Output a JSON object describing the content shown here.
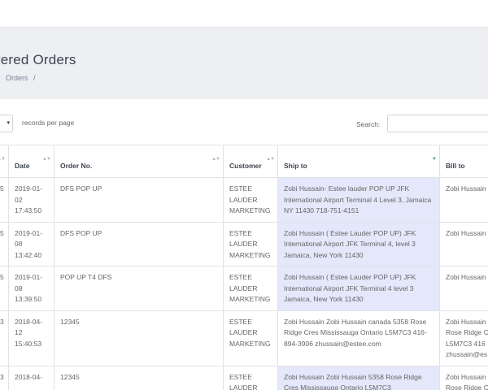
{
  "header": {
    "title": "vered Orders",
    "breadcrumb": [
      "Orders",
      "/"
    ]
  },
  "controls": {
    "length_caret": "▾",
    "length_label": "records per page",
    "search_label": "Search:",
    "search_value": ""
  },
  "table": {
    "columns": [
      "",
      "Date",
      "Order No.",
      "Customer",
      "Ship to",
      "Bill to"
    ],
    "rows": [
      {
        "stub": "5",
        "date": "2019-01-\n02\n17:43:50",
        "order": "DFS POP UP",
        "customer": "ESTEE\nLAUDER\nMARKETING",
        "ship_to": "Zobi Hussain- Estee lauder POP UP JFK International Airport Terminal 4 Level 3, Jamaica NY 11430 718-751-4151",
        "bill_to": "Zobi Hussain"
      },
      {
        "stub": "5",
        "date": "2019-01-\n08\n13:42:40",
        "order": "DFS POP UP",
        "customer": "ESTEE\nLAUDER\nMARKETING",
        "ship_to": "Zobi Hussain ( Estee Lauder POP UP) JFK International Airport JFK Terminal 4, level 3 Jamaica, New York 11430",
        "bill_to": "Zobi Hussain"
      },
      {
        "stub": "5",
        "date": "2019-01-\n08\n13:39:50",
        "order": "POP UP T4 DFS",
        "customer": "ESTEE\nLAUDER\nMARKETING",
        "ship_to": "Zobi Hussain ( Estee Lauder POP UP) JFK International Airport JFK Terminal 4 level 3 Jamaica, New York 11430",
        "bill_to": "Zobi Hussain"
      },
      {
        "stub": "3",
        "date": "2018-04-\n12\n15:40:53",
        "order": "12345",
        "customer": "ESTEE\nLAUDER\nMARKETING",
        "ship_to": "Zobi Hussain Zobi Hussain canada 5358 Rose Ridge Cres Mississauga Ontario L5M7C3 416-894-3906 zhussain@estee.com",
        "bill_to": "Zobi Hussain\nRose Ridge C\nL5M7C3 416\nzhussain@es"
      },
      {
        "stub": "3",
        "date": "2018-04-\n",
        "order": "12345",
        "customer": "ESTEE\nLAUDER",
        "ship_to": "Zobi Hussain Zobi Hussain 5358 Rose Ridge Cres Mississauga Ontario L5M7C3",
        "bill_to": "Zobi Hussain\nRose Ridge C"
      }
    ]
  },
  "colors": {
    "header_bg": "#edeff3",
    "highlight": "#e5e7fb",
    "sort_active": "#3ba3a0"
  }
}
